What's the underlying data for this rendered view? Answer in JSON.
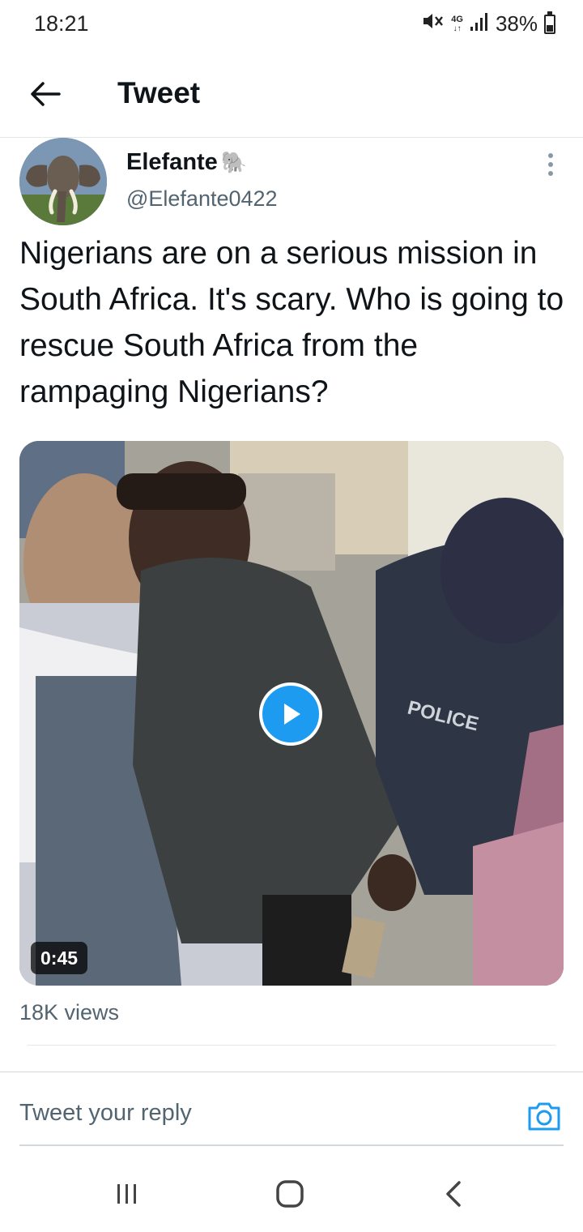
{
  "status_bar": {
    "time": "18:21",
    "network": "4G",
    "battery": "38%"
  },
  "header": {
    "title": "Tweet",
    "back_icon": "arrow-left-icon"
  },
  "tweet": {
    "author_name": "Elefante",
    "author_emoji": "🐘",
    "author_handle": "@Elefante0422",
    "text": "Nigerians are on a serious mission in South Africa. It's scary. Who is going to rescue South Africa from the rampaging Nigerians?",
    "media": {
      "type": "video",
      "duration": "0:45",
      "visible_text": "POLICE"
    },
    "views": "18K views"
  },
  "reply_bar": {
    "placeholder": "Tweet your reply",
    "camera_icon": "camera-icon"
  },
  "colors": {
    "accent": "#1d9bf0",
    "text_primary": "#0f1419",
    "text_secondary": "#536471"
  }
}
